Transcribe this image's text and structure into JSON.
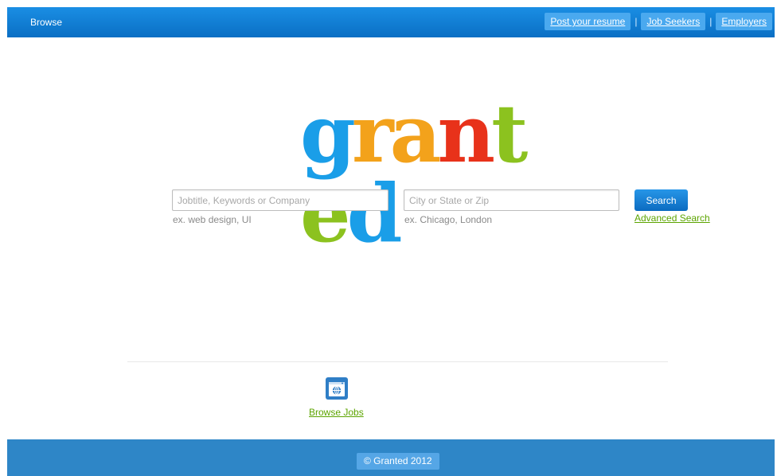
{
  "header": {
    "browse_label": "Browse",
    "nav": [
      {
        "label": "Post your resume"
      },
      {
        "label": "Job Seekers"
      },
      {
        "label": "Employers"
      }
    ],
    "separator": "|"
  },
  "logo": {
    "letters": [
      {
        "char": "g",
        "color": "#1a9ee8"
      },
      {
        "char": "r",
        "color": "#f3a21b"
      },
      {
        "char": "a",
        "color": "#f3a21b"
      },
      {
        "char": "n",
        "color": "#e8321a"
      },
      {
        "char": "t",
        "color": "#8cc21f"
      },
      {
        "char": "e",
        "color": "#8cc21f"
      },
      {
        "char": "d",
        "color": "#1a9ee8"
      }
    ]
  },
  "search": {
    "keywords_placeholder": "Jobtitle, Keywords or Company",
    "keywords_value": "",
    "keywords_hint": "ex. web design, UI",
    "location_placeholder": "City or State or Zip",
    "location_value": "",
    "location_hint": "ex. Chicago, London",
    "button_label": "Search",
    "advanced_label": "Advanced Search"
  },
  "browse_jobs": {
    "label": "Browse Jobs",
    "icon": "globe-window-icon"
  },
  "footer": {
    "copyright": "© Granted 2012"
  },
  "colors": {
    "brand_blue": "#0a6fc4",
    "link_green": "#5ca400",
    "footer_blue": "#2e86c7"
  }
}
